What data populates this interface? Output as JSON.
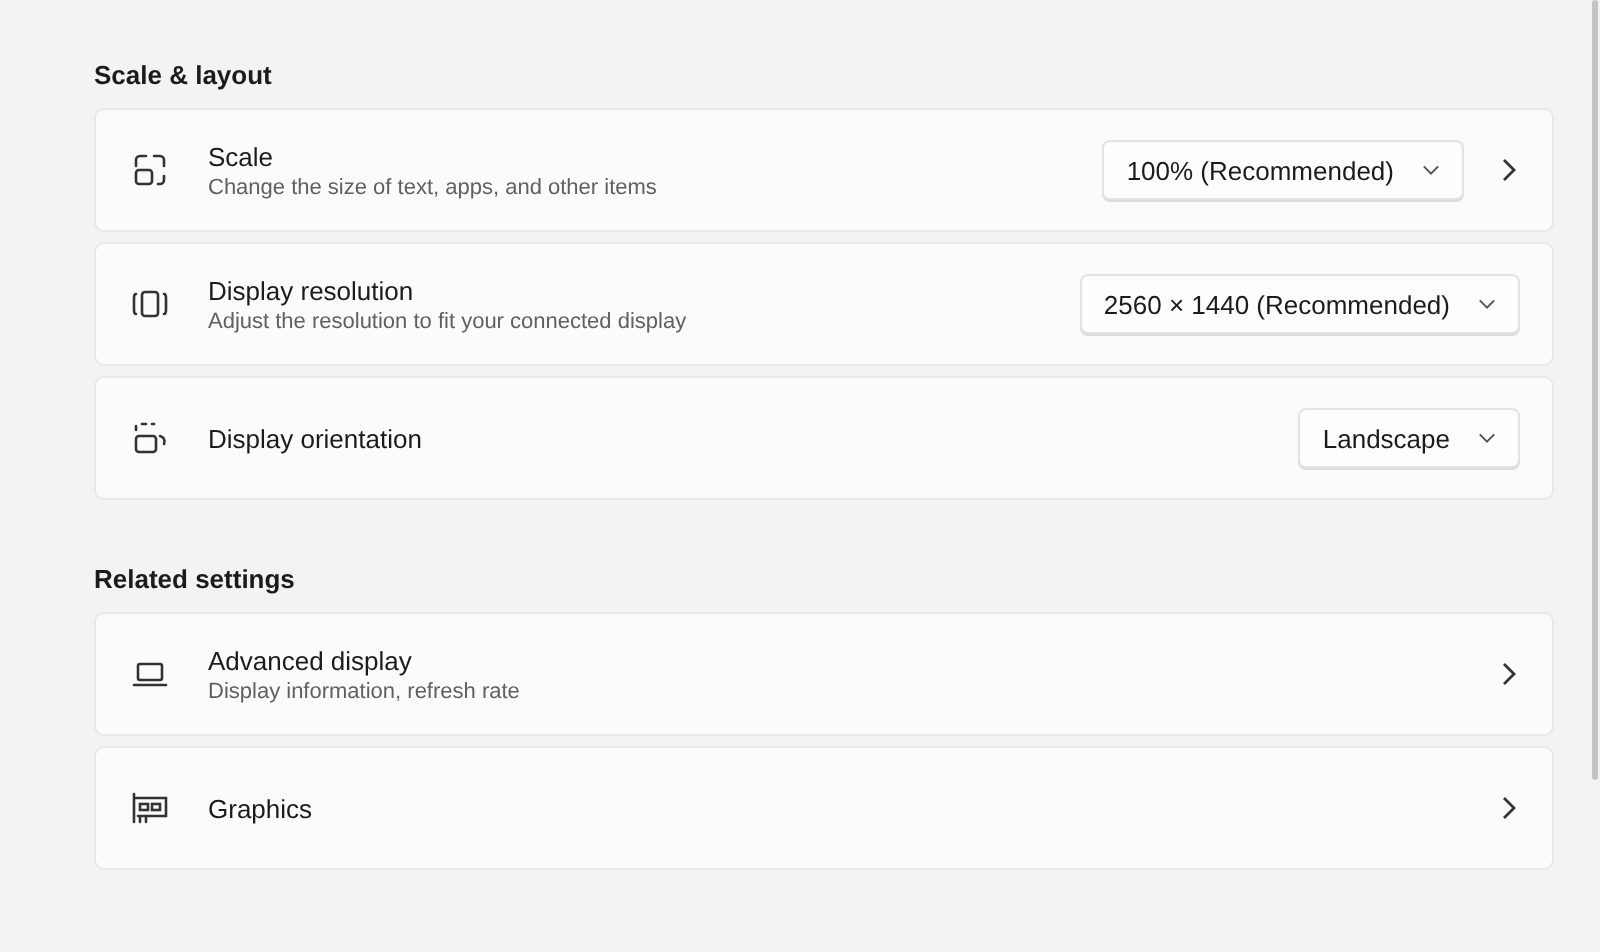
{
  "sections": [
    {
      "heading": "Scale & layout",
      "items": [
        {
          "kind": "scale",
          "title": "Scale",
          "subtitle": "Change the size of text, apps, and other items",
          "dropdown": "100% (Recommended)",
          "chevron": true
        },
        {
          "kind": "resolution",
          "title": "Display resolution",
          "subtitle": "Adjust the resolution to fit your connected display",
          "dropdown": "2560 × 1440 (Recommended)",
          "chevron": false
        },
        {
          "kind": "orientation",
          "title": "Display orientation",
          "dropdown": "Landscape",
          "chevron": false
        }
      ]
    },
    {
      "heading": "Related settings",
      "items": [
        {
          "kind": "laptop",
          "title": "Advanced display",
          "subtitle": "Display information, refresh rate",
          "chevron": true
        },
        {
          "kind": "graphics",
          "title": "Graphics",
          "chevron": true
        }
      ]
    }
  ]
}
